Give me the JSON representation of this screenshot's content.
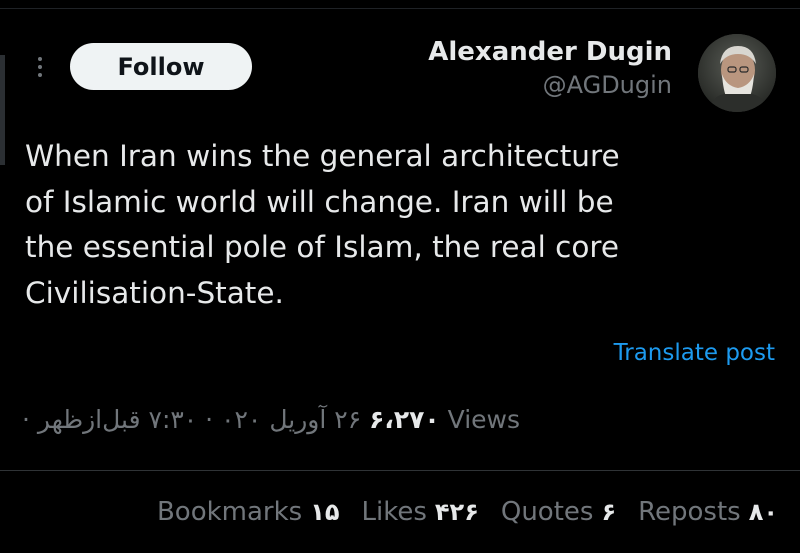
{
  "header": {
    "follow_label": "Follow",
    "display_name": "Alexander Dugin",
    "handle": "@AGDugin"
  },
  "tweet": {
    "lines": [
      "When Iran wins the general architecture",
      "of Islamic world will change. Iran will be",
      "the essential pole of Islam, the real core",
      "Civilisation-State."
    ]
  },
  "translate_label": "Translate post",
  "meta": {
    "timestamp": "۲۶ آوریل ۰۲۰ · ۷:۳۰ قبل‌ازظهر ·",
    "views_count": "۶،۲۷۰",
    "views_label": "Views"
  },
  "stats": [
    {
      "label": "Bookmarks",
      "count": "۱۵"
    },
    {
      "label": "Likes",
      "count": "۴۲۶"
    },
    {
      "label": "Quotes",
      "count": "۶"
    },
    {
      "label": "Reposts",
      "count": "۸۰"
    }
  ],
  "colors": {
    "background": "#000000",
    "text_primary": "#e7e9ea",
    "text_secondary": "#71767b",
    "link": "#1d9bf0",
    "follow_button_bg": "#eff3f4"
  },
  "icons": {
    "more": "more-vertical-icon"
  }
}
